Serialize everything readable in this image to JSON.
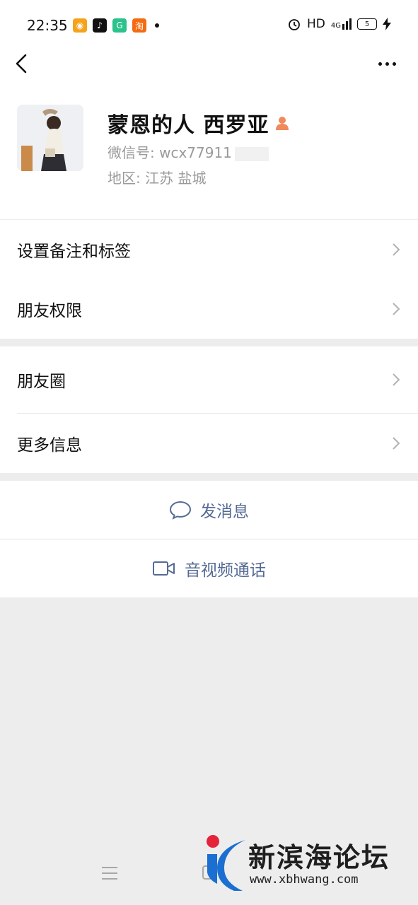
{
  "status_bar": {
    "time": "22:35",
    "app_icons": [
      "kuaishou-icon",
      "douyin-icon",
      "green-app-icon",
      "taobao-icon"
    ],
    "network": "HD",
    "signal": "4G",
    "battery": "5"
  },
  "profile": {
    "nickname": "蒙恩的人  西罗亚",
    "wechat_id": "微信号: wcx77911",
    "region": "地区: 江苏  盐城"
  },
  "menu_group_1": [
    {
      "label": "设置备注和标签"
    },
    {
      "label": "朋友权限"
    }
  ],
  "menu_group_2": [
    {
      "label": "朋友圈"
    },
    {
      "label": "更多信息"
    }
  ],
  "actions": {
    "message_label": "发消息",
    "call_label": "音视频通话"
  },
  "watermark": {
    "title": "新滨海论坛",
    "url": "www.xbhwang.com"
  },
  "colors": {
    "action_text": "#556b95",
    "background": "#ededed",
    "watermark_red": "#e5243b",
    "watermark_blue": "#1b6fd1"
  }
}
